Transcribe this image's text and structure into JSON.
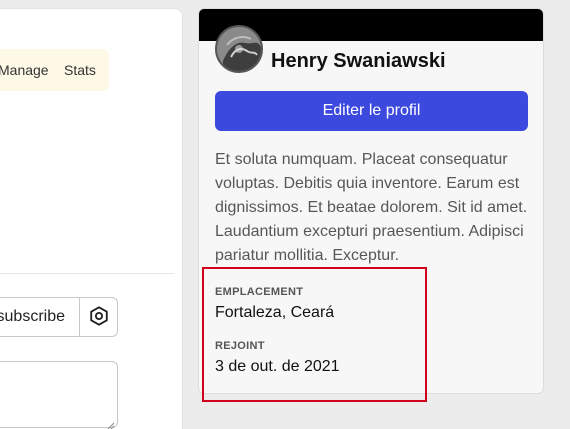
{
  "left_panel": {
    "nav": {
      "manage_label": "Manage",
      "stats_label": "Stats"
    },
    "subscribe_label": "subscribe",
    "settings_icon": "hexagon-settings-icon",
    "textarea_value": ""
  },
  "profile": {
    "name": "Henry Swaniawski",
    "edit_button_label": "Editer le profil",
    "bio": "Et soluta numquam. Placeat consequatur voluptas. Debitis quia inventore. Earum est dignissimos. Et beatae dolorem. Sit id amet. Laudantium excepturi praesentium. Adipisci pariatur mollitia. Exceptur.",
    "location": {
      "label": "EMPLACEMENT",
      "value": "Fortaleza, Ceará"
    },
    "joined": {
      "label": "REJOINT",
      "value": "3 de out. de 2021"
    },
    "banner_color": "#000000"
  },
  "colors": {
    "accent": "#3b49df",
    "highlight": "#d0021b",
    "nav_bg": "#fdf9e6"
  }
}
